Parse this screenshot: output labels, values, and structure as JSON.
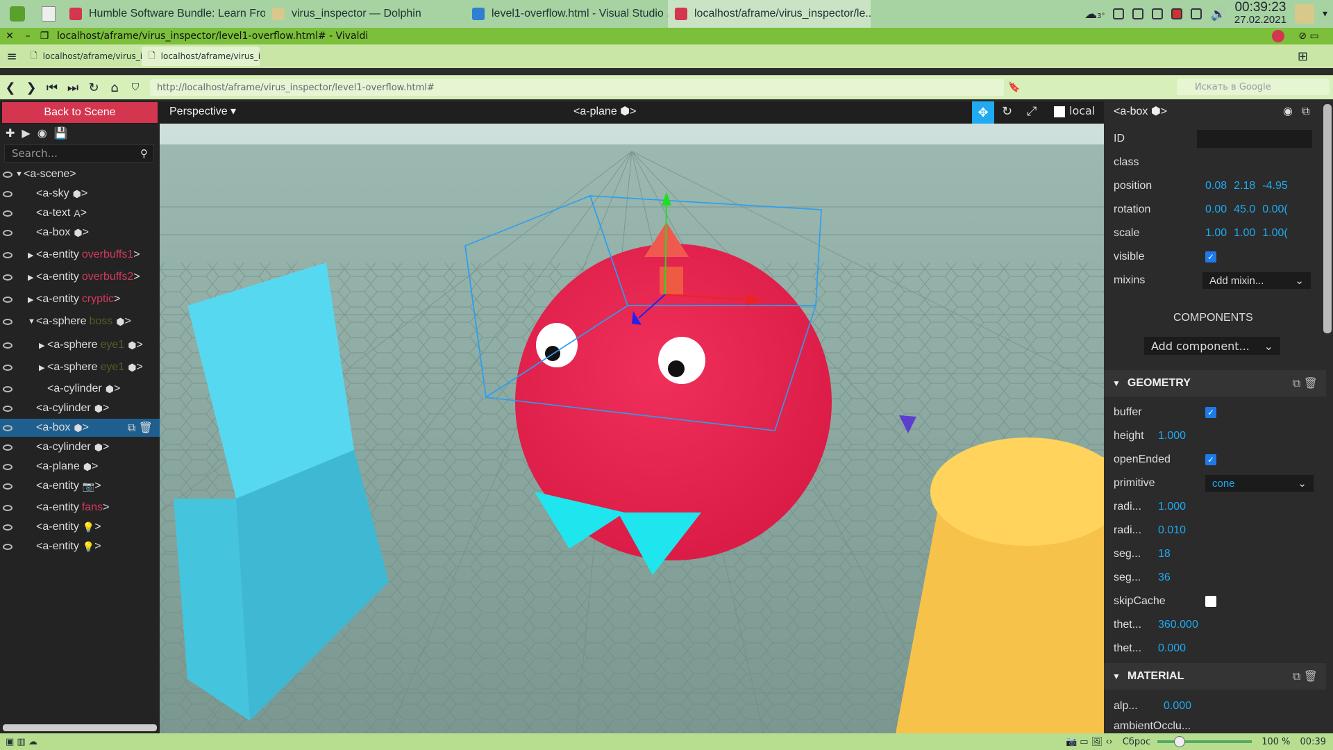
{
  "taskbar": {
    "tasks": [
      {
        "label": "Humble Software Bundle: Learn Fro...",
        "icon": "vivaldi-icon",
        "color": "#d4354f"
      },
      {
        "label": "virus_inspector — Dolphin",
        "icon": "folder-icon",
        "color": "#d8c98a"
      },
      {
        "label": "level1-overflow.html - Visual Studio ...",
        "icon": "vscode-icon",
        "color": "#2f80d0"
      },
      {
        "label": "localhost/aframe/virus_inspector/le...",
        "icon": "vivaldi-icon",
        "color": "#d4354f"
      }
    ],
    "weather": "3°",
    "time": "00:39:23",
    "date": "27.02.2021"
  },
  "browser": {
    "window_title": "localhost/aframe/virus_inspector/level1-overflow.html# - Vivaldi",
    "tabs": [
      "localhost/aframe/virus_ins",
      "localhost/aframe/virus_ins"
    ],
    "url": "http://localhost/aframe/virus_inspector/level1-overflow.html#",
    "search_placeholder": "Искать в Google"
  },
  "inspector": {
    "back_label": "Back to Scene",
    "camera_label": "Perspective",
    "selected_title": "<a-plane",
    "local_label": "local",
    "search_placeholder": "Search...",
    "tree": [
      {
        "tag": "<a-scene>",
        "cls": "",
        "icon": "",
        "indent": 0,
        "arrow": "open"
      },
      {
        "tag": "<a-sky",
        "cls": "",
        "icon": "cube",
        "indent": 1,
        "arrow": ""
      },
      {
        "tag": "<a-text",
        "cls": "",
        "icon": "A",
        "indent": 1,
        "arrow": ""
      },
      {
        "tag": "<a-box",
        "cls": "",
        "icon": "cube",
        "indent": 1,
        "arrow": ""
      },
      {
        "tag": "<a-entity",
        "cls": "overbuffs1",
        "icon": "",
        "indent": 1,
        "arrow": "closed"
      },
      {
        "tag": "<a-entity",
        "cls": "overbuffs2",
        "icon": "",
        "indent": 1,
        "arrow": "closed"
      },
      {
        "tag": "<a-entity",
        "cls": "cryptic",
        "icon": "",
        "indent": 1,
        "arrow": "closed"
      },
      {
        "tag": "<a-sphere",
        "cls": "boss",
        "icon": "cube",
        "indent": 1,
        "arrow": "open"
      },
      {
        "tag": "<a-sphere",
        "cls": "eye1",
        "icon": "cube",
        "indent": 2,
        "arrow": "closed"
      },
      {
        "tag": "<a-sphere",
        "cls": "eye1",
        "icon": "cube",
        "indent": 2,
        "arrow": "closed"
      },
      {
        "tag": "<a-cylinder",
        "cls": "",
        "icon": "cube",
        "indent": 2,
        "arrow": ""
      },
      {
        "tag": "<a-cylinder",
        "cls": "",
        "icon": "cube",
        "indent": 1,
        "arrow": ""
      },
      {
        "tag": "<a-box",
        "cls": "",
        "icon": "cube",
        "indent": 1,
        "arrow": "",
        "selected": true
      },
      {
        "tag": "<a-cylinder",
        "cls": "",
        "icon": "cube",
        "indent": 1,
        "arrow": ""
      },
      {
        "tag": "<a-plane",
        "cls": "",
        "icon": "cube",
        "indent": 1,
        "arrow": ""
      },
      {
        "tag": "<a-entity",
        "cls": "",
        "icon": "camera",
        "indent": 1,
        "arrow": ""
      },
      {
        "tag": "<a-entity",
        "cls": "fans",
        "icon": "",
        "indent": 1,
        "arrow": ""
      },
      {
        "tag": "<a-entity",
        "cls": "",
        "icon": "light",
        "indent": 1,
        "arrow": ""
      },
      {
        "tag": "<a-entity",
        "cls": "",
        "icon": "light",
        "indent": 1,
        "arrow": ""
      }
    ]
  },
  "panel": {
    "entity_title": "<a-box",
    "id_label": "ID",
    "class_label": "class",
    "position_label": "position",
    "position": [
      "0.08",
      "2.18",
      "-4.95"
    ],
    "rotation_label": "rotation",
    "rotation": [
      "0.00",
      "45.0",
      "0.00("
    ],
    "scale_label": "scale",
    "scale": [
      "1.00",
      "1.00",
      "1.00("
    ],
    "visible_label": "visible",
    "mixins_label": "mixins",
    "mixins_value": "Add mixin...",
    "components_label": "COMPONENTS",
    "add_component": "Add component...",
    "geometry_title": "GEOMETRY",
    "geometry": [
      {
        "label": "buffer",
        "type": "check",
        "value": true
      },
      {
        "label": "height",
        "type": "num",
        "value": "1.000"
      },
      {
        "label": "openEnded",
        "type": "check",
        "value": true
      },
      {
        "label": "primitive",
        "type": "select",
        "value": "cone"
      },
      {
        "label": "radi...",
        "type": "num",
        "value": "1.000"
      },
      {
        "label": "radi...",
        "type": "num",
        "value": "0.010"
      },
      {
        "label": "seg...",
        "type": "num",
        "value": "18"
      },
      {
        "label": "seg...",
        "type": "num",
        "value": "36"
      },
      {
        "label": "skipCache",
        "type": "check",
        "value": false
      },
      {
        "label": "thet...",
        "type": "num",
        "value": "360.000"
      },
      {
        "label": "thet...",
        "type": "num",
        "value": "0.000"
      }
    ],
    "material_title": "MATERIAL",
    "material": [
      {
        "label": "alp...",
        "value": "0.000"
      },
      {
        "label": "ambientOcclu...",
        "value": ""
      }
    ]
  },
  "status": {
    "reset": "Сброс",
    "zoom": "100 %",
    "time": "00:39"
  },
  "colors": {
    "accent": "#1faaf2",
    "back_button": "#d4354f",
    "class_tag": "#d23a5a",
    "virus": "#e8214b",
    "ground": "#7fa39a"
  }
}
